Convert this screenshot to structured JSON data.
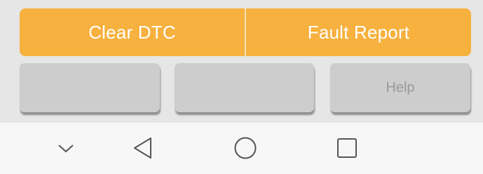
{
  "actions": {
    "clear_dtc": "Clear DTC",
    "fault_report": "Fault Report"
  },
  "buttons": {
    "button_1": "",
    "button_2": "",
    "help": "Help"
  },
  "navigation": {
    "icons": [
      "chevron-down-icon",
      "back-icon",
      "home-icon",
      "recent-apps-icon"
    ]
  },
  "colors": {
    "accent": "#f7b13e",
    "button_grey": "#cdcdcd",
    "background": "#e6e6e6",
    "nav_background": "#f7f7f7"
  }
}
